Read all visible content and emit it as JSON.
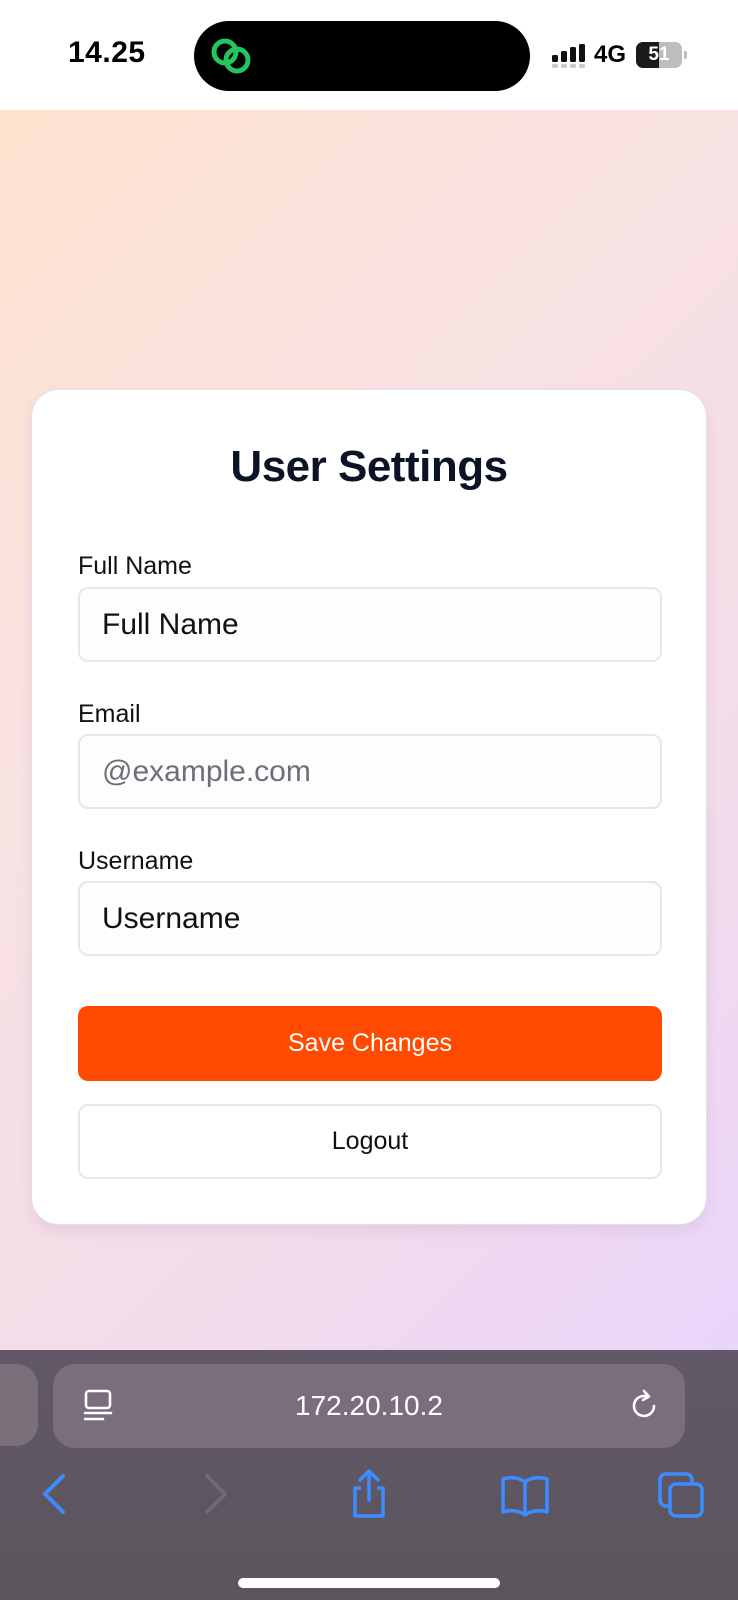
{
  "status_bar": {
    "time": "14.25",
    "network": "4G",
    "battery_text": "51",
    "battery_level": 0.51,
    "island_app_icon": "link-rings-icon",
    "signal_icon": "cellular-signal-icon"
  },
  "card": {
    "title": "User Settings",
    "fields": [
      {
        "label": "Full Name",
        "placeholder": "Full Name",
        "value": ""
      },
      {
        "label": "Email",
        "placeholder": "@example.com",
        "value": ""
      },
      {
        "label": "Username",
        "placeholder": "Username",
        "value": ""
      }
    ],
    "save_label": "Save Changes",
    "logout_label": "Logout"
  },
  "browser": {
    "url": "172.20.10.2",
    "icons": [
      "reader-icon",
      "reload-icon",
      "back-icon",
      "forward-icon",
      "share-icon",
      "bookmarks-icon",
      "tabs-icon"
    ]
  },
  "colors": {
    "accent": "#ff4a00",
    "title": "#0d1326",
    "browser_bar": "#5f5862"
  }
}
